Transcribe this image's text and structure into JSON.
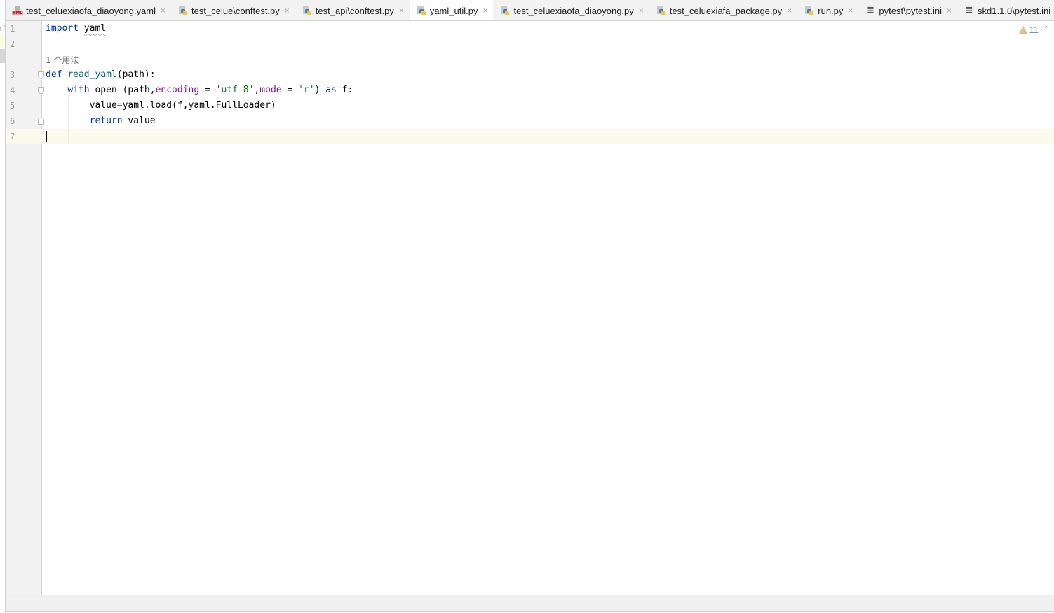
{
  "tabs": [
    {
      "label": "test_celuexiaofa_diaoyong.yaml",
      "icon": "yaml-file-icon",
      "active": false
    },
    {
      "label": "test_celue\\conftest.py",
      "icon": "python-file-icon",
      "active": false
    },
    {
      "label": "test_api\\conftest.py",
      "icon": "python-file-icon",
      "active": false
    },
    {
      "label": "yaml_util.py",
      "icon": "python-file-icon",
      "active": true
    },
    {
      "label": "test_celuexiaofa_diaoyong.py",
      "icon": "python-file-icon",
      "active": false
    },
    {
      "label": "test_celuexiafa_package.py",
      "icon": "python-file-icon",
      "active": false
    },
    {
      "label": "run.py",
      "icon": "python-file-icon",
      "active": false
    },
    {
      "label": "pytest\\pytest.ini",
      "icon": "ini-file-icon",
      "active": false
    },
    {
      "label": "skd1.1.0\\pytest.ini",
      "icon": "ini-file-icon",
      "active": false
    }
  ],
  "tab_close_glyph": "×",
  "editor": {
    "line_numbers": [
      "1",
      "2",
      "3",
      "4",
      "5",
      "6",
      "7"
    ],
    "usage_hint": "1 个用法",
    "lines": {
      "l1": {
        "kw": "import",
        "mod": "yaml"
      },
      "l3": {
        "kw": "def",
        "name": "read_yaml",
        "rest": "(path):"
      },
      "l4": {
        "kw1": "with",
        "fn": "open",
        "p1": "(path,",
        "param1": "encoding",
        "eq1": " = ",
        "str1": "'utf-8'",
        "comma": ",",
        "param2": "mode",
        "eq2": " = ",
        "str2": "'r'",
        "close": ") ",
        "kw2": "as",
        "tail": " f:"
      },
      "l5": {
        "text": "value=yaml.load(f,yaml.FullLoader)"
      },
      "l6": {
        "kw": "return",
        "text": " value"
      }
    },
    "current_line": 7
  },
  "inspections": {
    "warning_count": "11",
    "icon": "warning-icon"
  },
  "left_strip_text": "n'"
}
